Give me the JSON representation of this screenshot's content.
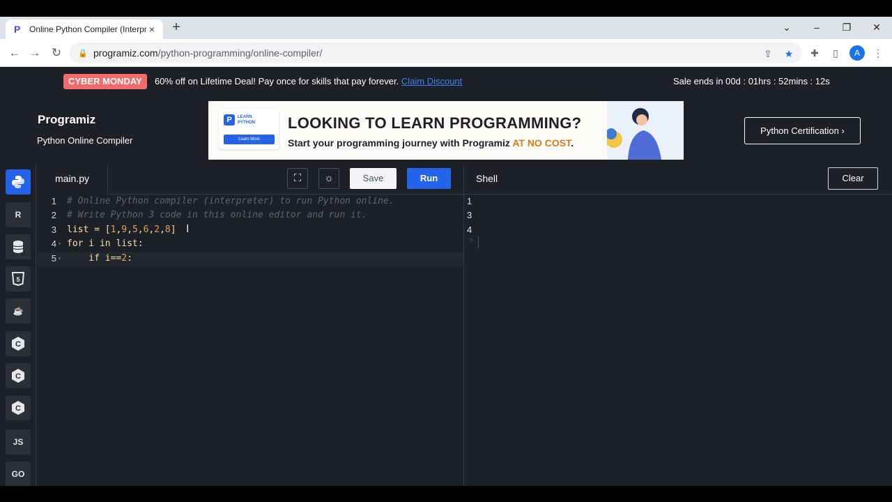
{
  "browser": {
    "tab_title": "Online Python Compiler (Interpr",
    "tab_close": "×",
    "new_tab": "+",
    "url_host": "programiz.com",
    "url_path": "/python-programming/online-compiler/",
    "avatar_letter": "A"
  },
  "promo": {
    "badge": "CYBER MONDAY",
    "text": "60% off on Lifetime Deal! Pay once for skills that pay forever.",
    "link": "Claim Discount",
    "sale_timer": "Sale ends in 00d : 01hrs : 52mins : 12s"
  },
  "header": {
    "logo": "Programiz",
    "subtitle": "Python Online Compiler",
    "cert_button": "Python Certification ›"
  },
  "banner": {
    "card_label": "LEARN PYTHON",
    "card_button": "Learn More",
    "headline": "LOOKING TO LEARN PROGRAMMING?",
    "subline": "Start your programming journey with Programiz",
    "highlight": "AT NO COST",
    "period": "."
  },
  "languages": [
    "Python",
    "R",
    "SQL",
    "HTML",
    "Java",
    "C",
    "C++",
    "C#",
    "JS",
    "GO"
  ],
  "editor": {
    "filename": "main.py",
    "save_label": "Save",
    "run_label": "Run",
    "lines": [
      {
        "n": "1",
        "text": "# Online Python compiler (interpreter) to run Python online."
      },
      {
        "n": "2",
        "text": "# Write Python 3 code in this online editor and run it."
      },
      {
        "n": "3",
        "text": "list = [1,9,5,6,2,8]"
      },
      {
        "n": "4",
        "text": "for i in list:"
      },
      {
        "n": "5",
        "text": "    if i==2:"
      }
    ]
  },
  "shell": {
    "title": "Shell",
    "clear_label": "Clear",
    "output": [
      "1",
      "3",
      "4"
    ],
    "prompt": ">"
  },
  "colors": {
    "accent": "#2563eb",
    "badge": "#f26b6b",
    "background": "#1d2026"
  }
}
